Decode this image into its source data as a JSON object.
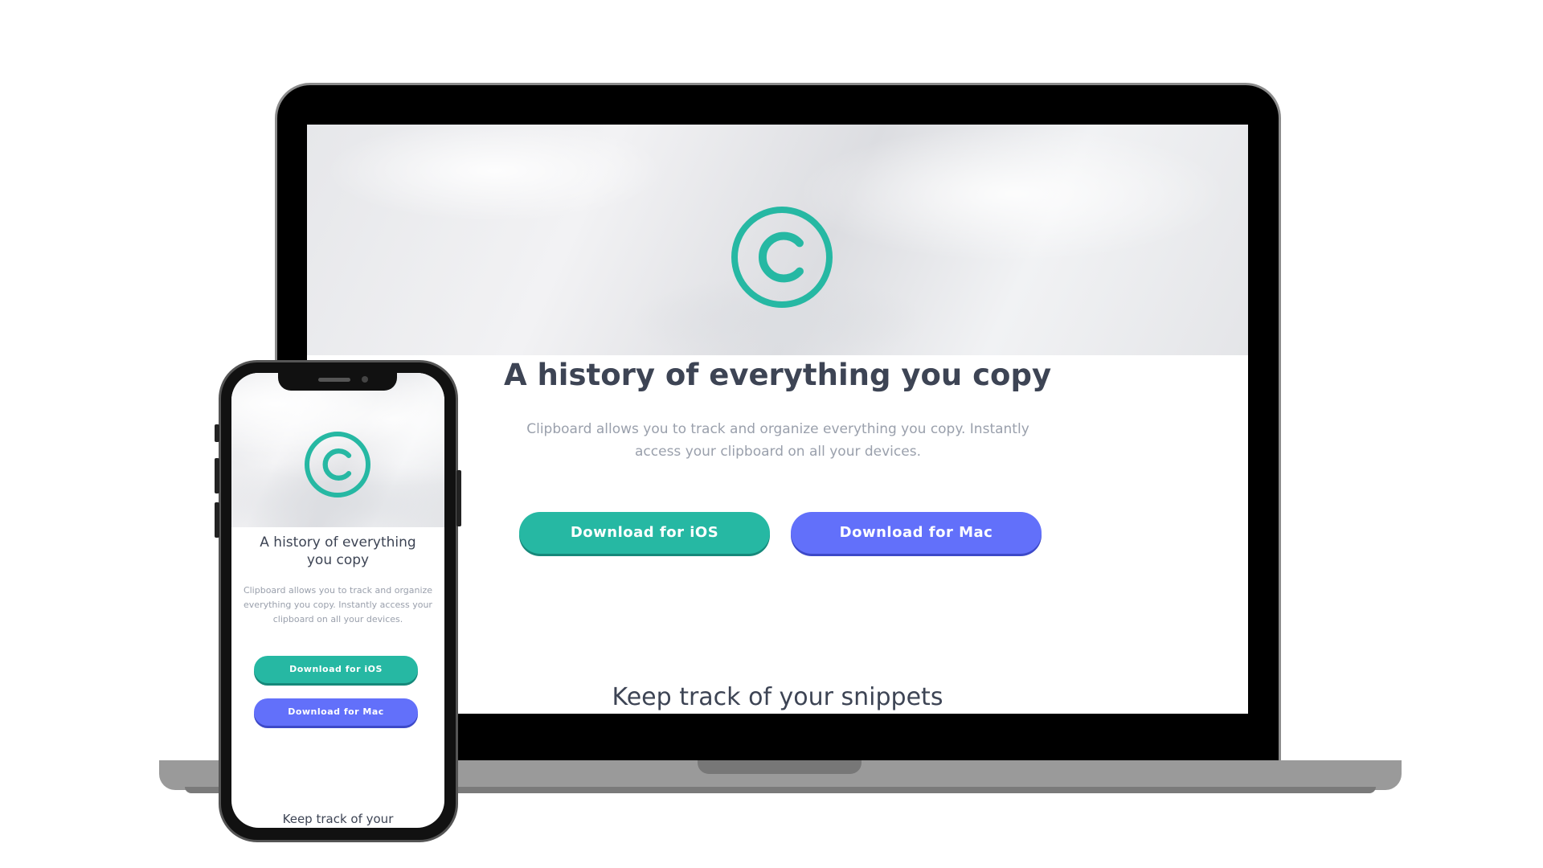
{
  "brand": {
    "accent_color": "#26b8a3",
    "mac_button_color": "#6270fa",
    "logo_icon": "copyright-icon"
  },
  "desktop": {
    "headline": "A history of everything you copy",
    "description": "Clipboard allows you to track and organize everything you copy. Instantly access your clipboard on all your devices.",
    "ios_button_label": "Download for iOS",
    "mac_button_label": "Download for Mac",
    "next_section_heading": "Keep track of your snippets"
  },
  "mobile": {
    "headline": "A history of everything you copy",
    "description": "Clipboard allows you to track and organize everything you copy. Instantly access your clipboard on all your devices.",
    "ios_button_label": "Download for iOS",
    "mac_button_label": "Download for Mac",
    "next_section_heading": "Keep track of your"
  }
}
